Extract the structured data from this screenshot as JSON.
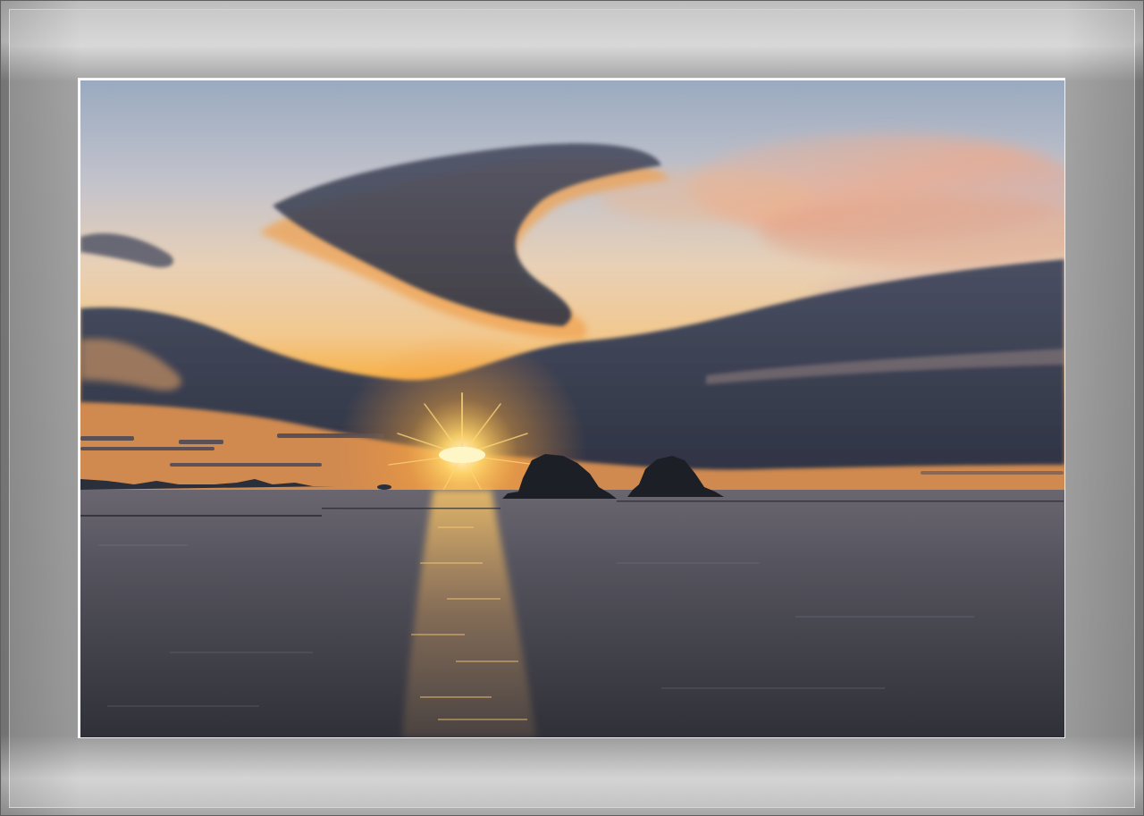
{
  "scene": {
    "subject": "sunset-over-sea-with-two-rocky-islets",
    "palette": {
      "sky_top": "#8fa3bd",
      "sky_mid": "#e9c7a1",
      "horizon_glow": "#f6b44a",
      "sun": "#fff3b0",
      "cloud_dark": "#3d4356",
      "cloud_lit": "#f0a04e",
      "sea": "#55555e",
      "sea_dark": "#2c2c34",
      "mat": "#9a9a9a"
    }
  }
}
